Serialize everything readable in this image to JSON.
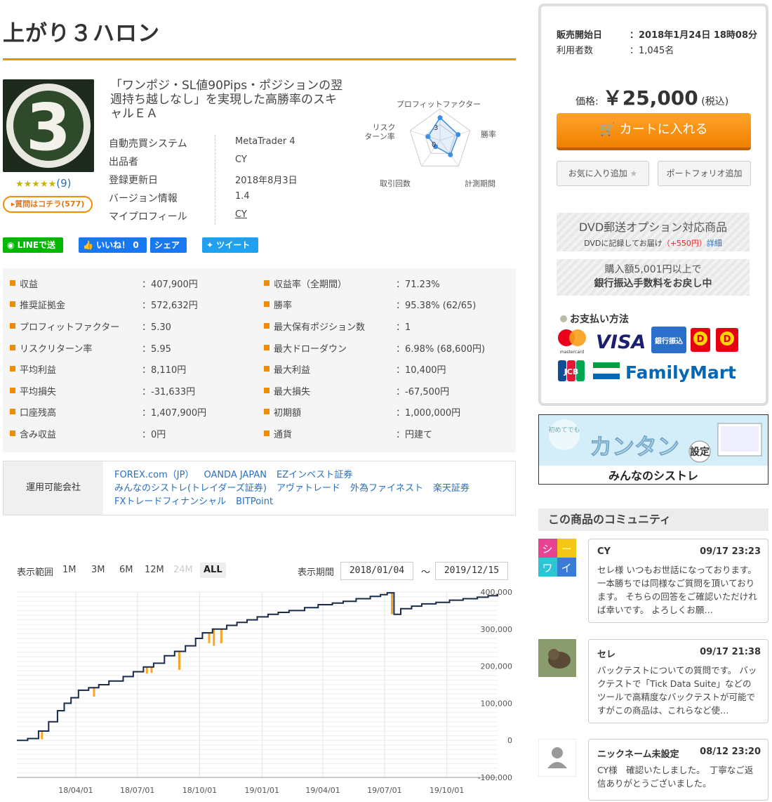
{
  "title": "上がり３ハロン",
  "product": {
    "icon_number": "3",
    "rating_stars": "★★★★★",
    "rating_count": "(9)",
    "question_button": "質問はコチラ(577)",
    "description": "「ワンポジ・SL値90Pips・ポジションの翌週持ち越しなし」を実現した高勝率のスキャルＥＡ"
  },
  "info": [
    {
      "key": "自動売買システム",
      "value": "MetaTrader 4"
    },
    {
      "key": "出品者",
      "value": "CY"
    },
    {
      "key": "登録更新日",
      "value": "2018年8月3日"
    },
    {
      "key": "バージョン情報",
      "value": "1.4"
    },
    {
      "key": "マイプロフィール",
      "value": "CY"
    }
  ],
  "radar": {
    "labels": [
      "プロフィットファクター",
      "勝率",
      "計測期間",
      "取引回数",
      "リスクリターン率"
    ],
    "scale_labels": [
      "3",
      "0"
    ],
    "values": [
      3.6,
      3.0,
      2.8,
      1.2,
      2.0
    ],
    "max": 5
  },
  "share": {
    "line": "LINEで送る",
    "like": "いいね！ 0",
    "fb_share": "シェア",
    "tweet": "ツイート"
  },
  "stats_left": [
    {
      "key": "収益",
      "value": "：407,900円"
    },
    {
      "key": "推奨証拠金",
      "value": "：572,632円"
    },
    {
      "key": "プロフィットファクター",
      "value": "：5.30"
    },
    {
      "key": "リスクリターン率",
      "value": "：5.95"
    },
    {
      "key": "平均利益",
      "value": "：8,110円"
    },
    {
      "key": "平均損失",
      "value": "：-31,633円"
    },
    {
      "key": "口座残高",
      "value": "：1,407,900円"
    },
    {
      "key": "含み収益",
      "value": "：0円"
    }
  ],
  "stats_right": [
    {
      "key": "収益率（全期間）",
      "value": "：71.23%"
    },
    {
      "key": "勝率",
      "value": "：95.38% (62/65)"
    },
    {
      "key": "最大保有ポジション数",
      "value": "：1"
    },
    {
      "key": "最大ドローダウン",
      "value": "：6.98% (68,600円)"
    },
    {
      "key": "最大利益",
      "value": "：10,400円"
    },
    {
      "key": "最大損失",
      "value": "：-67,500円"
    },
    {
      "key": "初期額",
      "value": "：1,000,000円"
    },
    {
      "key": "通貨",
      "value": "：円建て"
    }
  ],
  "brokers": {
    "label": "運用可能会社",
    "rows": [
      [
        "FOREX.com（JP）",
        "OANDA JAPAN",
        "EZインベスト証券"
      ],
      [
        "みんなのシストレ(トレイダーズ証券)",
        "アヴァトレード",
        "外為ファイネスト",
        "楽天証券"
      ],
      [
        "FXトレードフィナンシャル",
        "BITPoint"
      ]
    ]
  },
  "chart_controls": {
    "range_label": "表示範囲",
    "ranges": [
      "1M",
      "3M",
      "6M",
      "12M",
      "24M",
      "ALL"
    ],
    "period_label": "表示期間",
    "date_from": "2018/01/04",
    "tilde": "～",
    "date_to": "2019/12/15"
  },
  "chart_data": {
    "type": "line",
    "x_tick_labels": [
      "18/04/01",
      "18/07/01",
      "18/10/01",
      "19/01/01",
      "19/04/01",
      "19/07/01",
      "19/10/01"
    ],
    "y_tick_labels": [
      "400,000",
      "300,000",
      "200,000",
      "100,000",
      "0",
      "-100,000"
    ],
    "ylim": [
      -100000,
      400000
    ],
    "xlim": [
      "2018-01-04",
      "2019-12-15"
    ],
    "series": [
      {
        "x": [
          "2018-01-04",
          "2018-01-20",
          "2018-02-05",
          "2018-02-20",
          "2018-03-05",
          "2018-03-15",
          "2018-03-25",
          "2018-04-05",
          "2018-04-20",
          "2018-05-05",
          "2018-05-20",
          "2018-06-10",
          "2018-06-25",
          "2018-07-10",
          "2018-07-25",
          "2018-08-10",
          "2018-08-25",
          "2018-09-10",
          "2018-09-25",
          "2018-10-05",
          "2018-10-20",
          "2018-11-10",
          "2018-11-25",
          "2018-12-10",
          "2018-12-25",
          "2019-01-10",
          "2019-01-25",
          "2019-02-10",
          "2019-03-05",
          "2019-03-25",
          "2019-04-15",
          "2019-05-01",
          "2019-05-20",
          "2019-06-10",
          "2019-06-25",
          "2019-07-05",
          "2019-07-15",
          "2019-07-25",
          "2019-08-10",
          "2019-08-25",
          "2019-09-15",
          "2019-10-05",
          "2019-10-25",
          "2019-11-15",
          "2019-12-01",
          "2019-12-15"
        ],
        "y": [
          0,
          5000,
          25000,
          50000,
          80000,
          100000,
          115000,
          135000,
          142000,
          150000,
          160000,
          172000,
          185000,
          198000,
          208000,
          228000,
          240000,
          255000,
          275000,
          290000,
          300000,
          310000,
          318000,
          325000,
          333000,
          340000,
          345000,
          350000,
          358000,
          366000,
          370000,
          375000,
          382000,
          388000,
          393000,
          398000,
          340000,
          355000,
          362000,
          368000,
          372000,
          378000,
          382000,
          386000,
          390000,
          395000
        ]
      }
    ],
    "drawdown_spikes": [
      {
        "x": "2018-02-10",
        "y": 3000
      },
      {
        "x": "2018-04-28",
        "y": 118000
      },
      {
        "x": "2018-07-15",
        "y": 180000
      },
      {
        "x": "2018-07-22",
        "y": 182000
      },
      {
        "x": "2018-09-01",
        "y": 190000
      },
      {
        "x": "2018-10-15",
        "y": 262000
      },
      {
        "x": "2018-10-22",
        "y": 255000
      },
      {
        "x": "2018-11-02",
        "y": 262000
      },
      {
        "x": "2019-07-12",
        "y": 340000
      }
    ]
  },
  "sidebar": {
    "sale_start_key": "販売開始日",
    "sale_start_value": "：2018年1月24日 18時08分",
    "users_key": "利用者数",
    "users_value": "：1,045名",
    "price_label": "価格:",
    "price_value": "￥25,000",
    "price_tax": "(税込)",
    "cart_button": "カートに入れる",
    "favorite_button": "お気に入り追加",
    "portfolio_button": "ポートフォリオ追加",
    "dvd_title": "DVD郵送オプション対応商品",
    "dvd_sub": "DVDに記録してお届け",
    "dvd_price": "（+550円）",
    "dvd_detail": "詳細",
    "refund_line1": "購入額5,001円以上で",
    "refund_line2": "銀行振込手数料をお戻し中",
    "payment_title": "お支払い方法",
    "payment": {
      "mastercard": "mastercard",
      "visa": "VISA",
      "bank": "銀行振込",
      "jcb": "JCB",
      "familymart": "FamilyMart"
    }
  },
  "banner": {
    "first_time": "初めてでも",
    "kantan": "カンタン",
    "settei": "設定",
    "brand": "みんなのシストレ"
  },
  "community": {
    "title": "この商品のコミュニティ",
    "comments": [
      {
        "user": "CY",
        "date": "09/17 23:23",
        "body": "セレ様 いつもお世話になっております。 一本勝ちでは同様なご質問を頂いております。 そちらの回答をご確認いただければ幸いです。 よろしくお願…"
      },
      {
        "user": "セレ",
        "date": "09/17 21:38",
        "body": "バックテストについての質問です。 バックテストで「Tick Data Suite」などのツールで高精度なバックテストが可能ですがこの商品は、これらなど使…"
      },
      {
        "user": "ニックネーム未設定",
        "date": "08/12 23:20",
        "body": "CY様　確認いたしました。　丁寧なご返信ありがとうございました。"
      }
    ],
    "avatar_text_1": [
      "シ",
      "ー",
      "ワ",
      "イ"
    ]
  },
  "colors": {
    "accent": "#f08c00",
    "link": "#2a6fbf",
    "chart_line": "#1a2b4a",
    "chart_drawdown": "#f5a623"
  }
}
